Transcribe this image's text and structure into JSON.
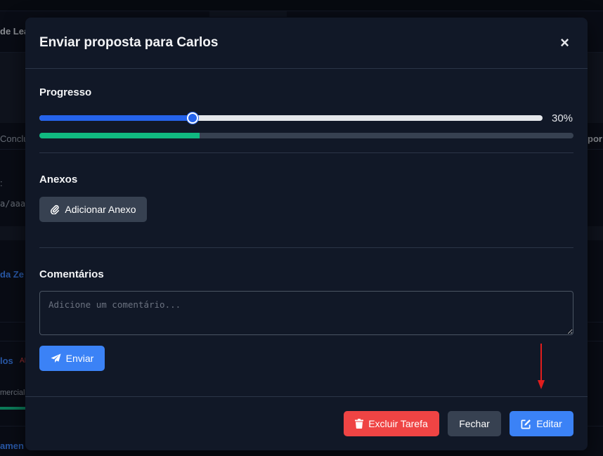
{
  "background": {
    "fragments": [
      {
        "text": "de Lea"
      },
      {
        "text": "Conclu"
      },
      {
        "text": ":"
      },
      {
        "text": "a/aaaa"
      },
      {
        "text": "da Ze"
      },
      {
        "text": "los"
      },
      {
        "text": "mercial"
      },
      {
        "text": "amen"
      },
      {
        "text": "por"
      }
    ],
    "badge": "AL"
  },
  "modal": {
    "title": "Enviar proposta para Carlos",
    "close_label": "×",
    "progress": {
      "label": "Progresso",
      "value": 30,
      "value_text": "30%"
    },
    "attachments": {
      "label": "Anexos",
      "add_button": "Adicionar Anexo"
    },
    "comments": {
      "label": "Comentários",
      "placeholder": "Adicione um comentário...",
      "value": "",
      "send_button": "Enviar"
    },
    "footer": {
      "delete_button": "Excluir Tarefa",
      "close_button": "Fechar",
      "edit_button": "Editar"
    }
  },
  "colors": {
    "primary": "#3b82f6",
    "slider": "#2563eb",
    "success": "#10b981",
    "danger": "#ef4444",
    "secondary": "#374151",
    "annotation_arrow": "#e11d1d"
  },
  "icons": {
    "close": "close-icon",
    "attach": "paperclip-icon",
    "send": "paper-plane-icon",
    "delete": "trash-icon",
    "edit": "edit-icon"
  }
}
